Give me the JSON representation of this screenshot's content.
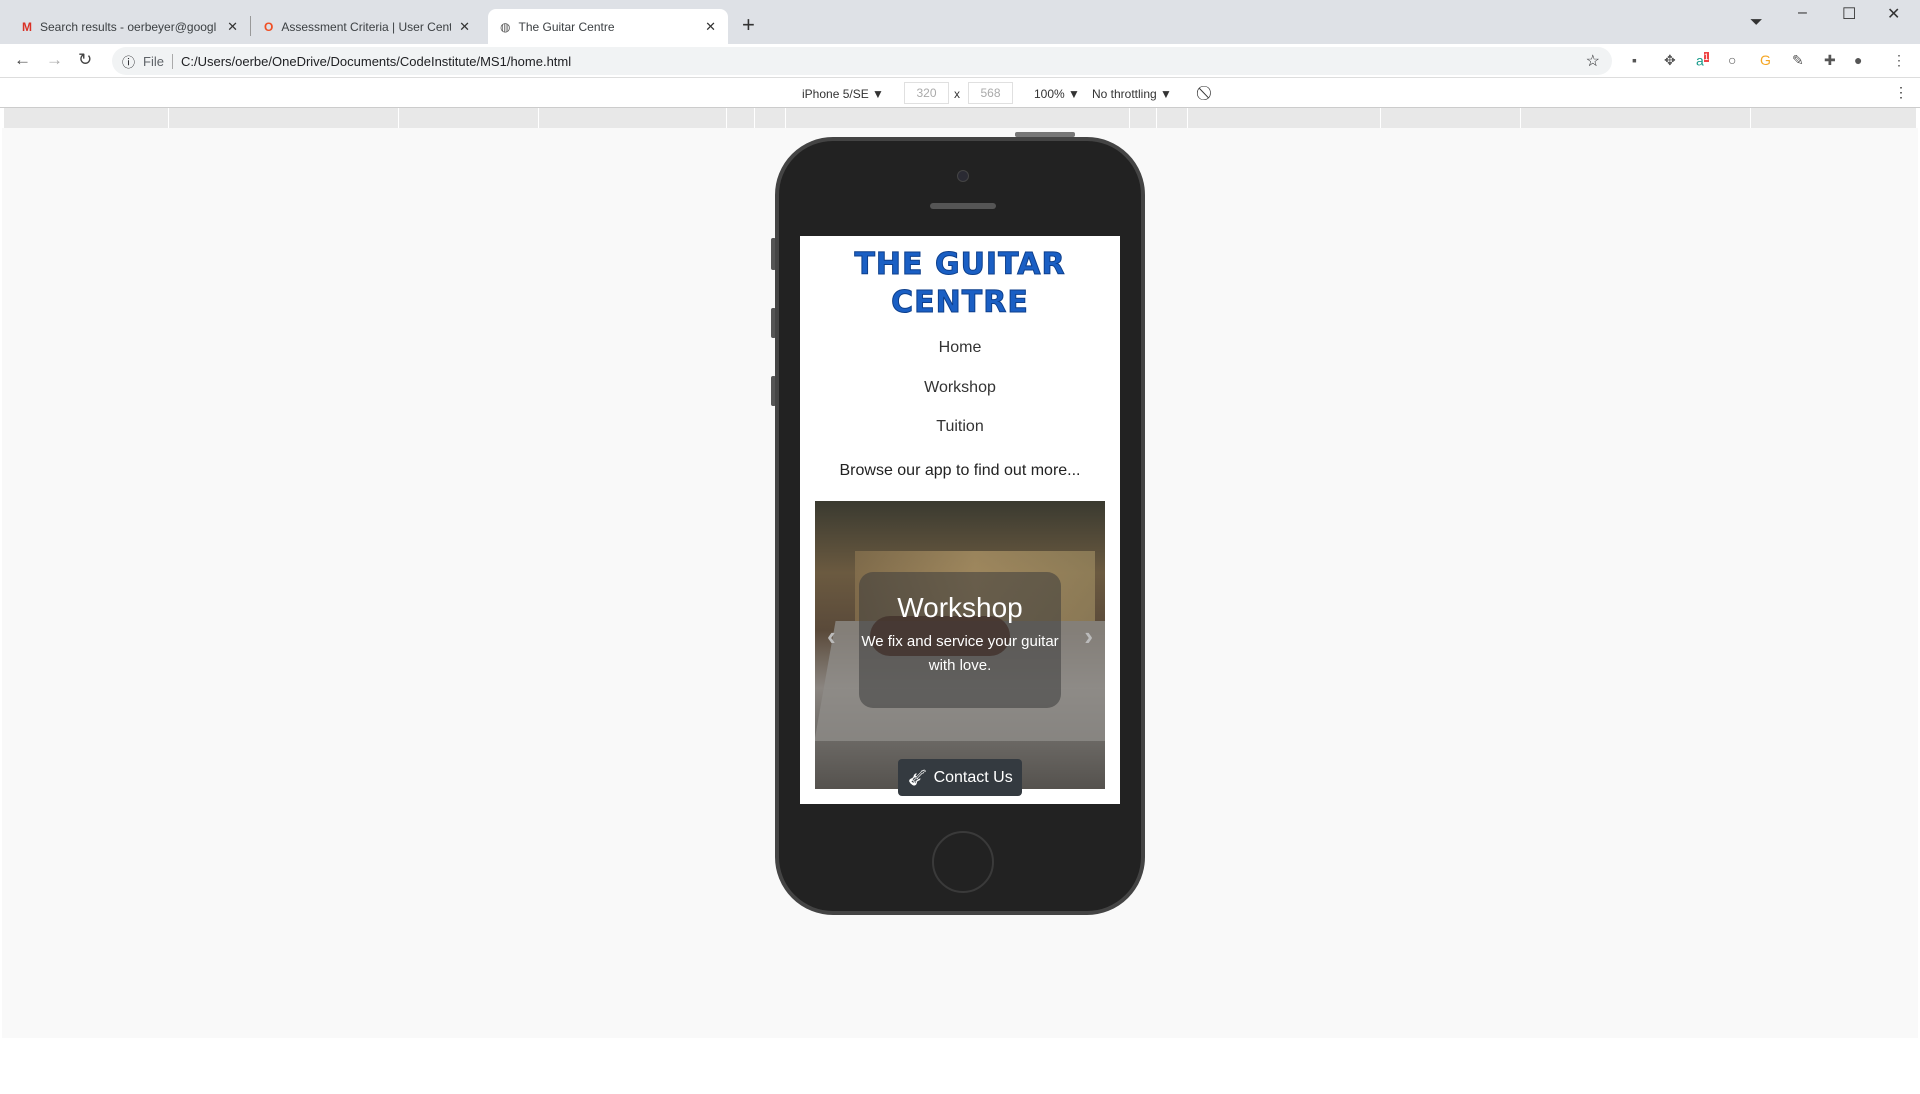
{
  "browser": {
    "tabs": [
      {
        "label": "Search results - oerbeyer@googl",
        "icon": "gmail-icon",
        "active": false
      },
      {
        "label": "Assessment Criteria | User Centric",
        "icon": "opera-icon",
        "active": false
      },
      {
        "label": "The Guitar Centre",
        "icon": "globe-icon",
        "active": true
      }
    ],
    "address_scheme": "File",
    "url": "C:/Users/oerbe/OneDrive/Documents/CodeInstitute/MS1/home.html",
    "extension_badge": "1"
  },
  "devtools": {
    "device": "iPhone 5/SE ▼",
    "width": "320",
    "times": "x",
    "height": "568",
    "zoom": "100% ▼",
    "throttling": "No throttling ▼"
  },
  "site": {
    "title_line1": "THE GUITAR",
    "title_line2": "CENTRE",
    "title_color": "#1a5fc4",
    "nav": [
      "Home",
      "Workshop",
      "Tuition"
    ],
    "tagline": "Browse our app to find out more...",
    "carousel": {
      "heading": "Workshop",
      "text": "We fix and service your guitar with love.",
      "prev": "‹",
      "next": "›"
    },
    "contact_label": "Contact Us"
  }
}
